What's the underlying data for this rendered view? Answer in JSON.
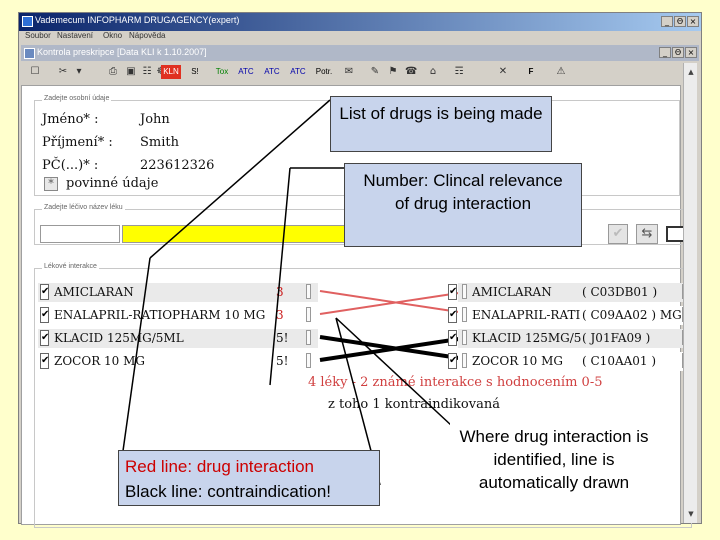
{
  "outer_window": {
    "title": "Vademecum INFOPHARM  DRUGAGENCY(expert)",
    "menu": [
      "Soubor",
      "Nastavení",
      "Okno",
      "Nápověda"
    ],
    "buttons": [
      "_",
      "Θ",
      "×"
    ]
  },
  "inner_window": {
    "title": "Kontrola preskripce [Data KLI k 1.10.2007]",
    "buttons": [
      "_",
      "Θ",
      "×"
    ]
  },
  "toolbar": {
    "items": [
      "☐",
      "✂",
      "▾",
      "⎙",
      "▣",
      "☷",
      "☸",
      "KLN",
      "S!",
      "Tox",
      "ATC",
      "ATC",
      "ATC",
      "Potr.",
      "✉",
      "✎",
      "⚑",
      "☎",
      "⌂",
      "☶",
      "✕",
      "F",
      "⚠"
    ]
  },
  "patient": {
    "legend": "Zadejte osobní údaje",
    "fields": [
      {
        "label": "Jméno* :",
        "value": "John"
      },
      {
        "label": "Příjmení* :",
        "value": "Smith"
      },
      {
        "label": "PČ(...)* :",
        "value": "223612326"
      }
    ],
    "required_marker": "*",
    "required_note": "povinné údaje"
  },
  "search": {
    "legend": "Zadejte léčivo název léku"
  },
  "interactions": {
    "legend": "Lékové interakce",
    "left_rows": [
      {
        "checked": "✔",
        "name": "AMICLARAN",
        "score": "3"
      },
      {
        "checked": "✔",
        "name": "ENALAPRIL-RATIOPHARM 10 MG",
        "score": "3"
      },
      {
        "checked": "✔",
        "name": "KLACID 125MG/5ML",
        "score": "5!"
      },
      {
        "checked": "✔",
        "name": "ZOCOR 10 MG",
        "score": "5!"
      }
    ],
    "right_rows": [
      {
        "checked": "✔",
        "name": "AMICLARAN",
        "code": "( C03DB01 )"
      },
      {
        "checked": "✔",
        "name": "ENALAPRIL-RATI",
        "code": "( C09AA02 ) MG"
      },
      {
        "checked": "✔",
        "name": "KLACID 125MG/5",
        "code": "( J01FA09 )"
      },
      {
        "checked": "✔",
        "name": "ZOCOR 10 MG",
        "code": "( C10AA01 )"
      }
    ],
    "summary": "4 léky - 2 známé interakce s hodnocením 0-5",
    "summary_sub": "z toho 1 kontraindikovaná"
  },
  "callouts": {
    "list_made": "List of drugs is being made",
    "number": "Number: Clincal relevance of drug interaction",
    "where": "Where drug interaction is identified, line is automatically drawn",
    "red_line": "Red line: drug interaction",
    "black_line": "Black line: contraindication!"
  },
  "colors": {
    "background": "#ffffcc",
    "callout": "#c8d4ec",
    "title_bar": "#0a246a",
    "search_highlight": "#ffff00",
    "interaction_line": "#e06060",
    "contraindication_line": "#000000"
  }
}
